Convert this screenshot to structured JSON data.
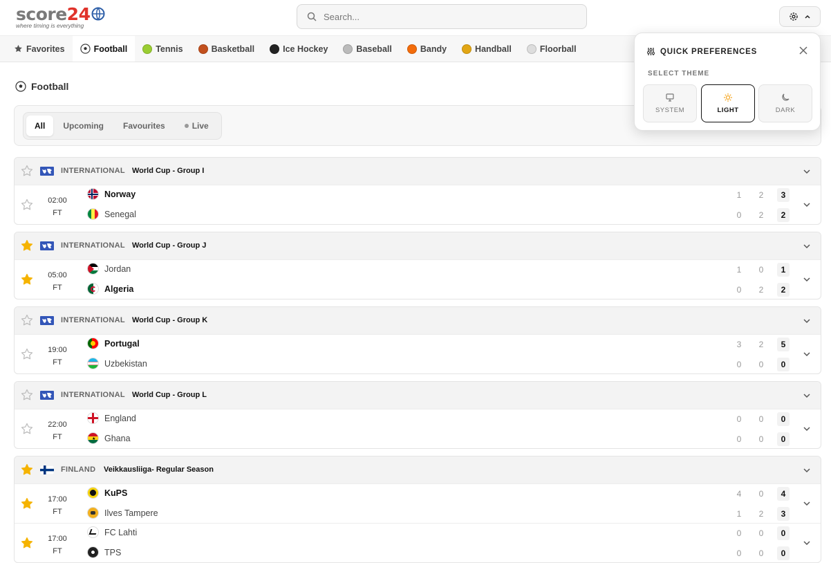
{
  "header": {
    "logo_main_grey": "score",
    "logo_main_red": "24",
    "logo_tagline": "where timing is everything",
    "search_placeholder": "Search..."
  },
  "sports": [
    {
      "label": "Favorites",
      "icon": "star-icon",
      "color": "#555"
    },
    {
      "label": "Football",
      "icon": "football-icon",
      "color": "#222",
      "active": true
    },
    {
      "label": "Tennis",
      "icon": "tennis-ball-icon",
      "color": "#9acd32"
    },
    {
      "label": "Basketball",
      "icon": "basketball-icon",
      "color": "#c2501e"
    },
    {
      "label": "Ice Hockey",
      "icon": "hockey-puck-icon",
      "color": "#222"
    },
    {
      "label": "Baseball",
      "icon": "baseball-icon",
      "color": "#bbb"
    },
    {
      "label": "Bandy",
      "icon": "bandy-ball-icon",
      "color": "#f36c0b"
    },
    {
      "label": "Handball",
      "icon": "handball-icon",
      "color": "#e2a614"
    },
    {
      "label": "Floorball",
      "icon": "floorball-icon",
      "color": "#ddd"
    }
  ],
  "section": {
    "title": "Football"
  },
  "filters": [
    {
      "label": "All",
      "active": true
    },
    {
      "label": "Upcoming"
    },
    {
      "label": "Favourites"
    },
    {
      "label": "Live"
    }
  ],
  "preferences": {
    "title": "QUICK PREFERENCES",
    "theme_label": "SELECT THEME",
    "themes": [
      {
        "label": "SYSTEM",
        "icon": "monitor-icon"
      },
      {
        "label": "LIGHT",
        "icon": "sun-icon",
        "active": true
      },
      {
        "label": "DARK",
        "icon": "moon-icon"
      }
    ]
  },
  "leagues": [
    {
      "country": "INTERNATIONAL",
      "name": "World Cup - Group I",
      "favorite": false,
      "flag": "world-flag-icon",
      "matches": [
        {
          "time": "02:00",
          "status": "FT",
          "favorite": false,
          "home": {
            "name": "Norway",
            "h1": "1",
            "h2": "2",
            "final": "3",
            "win": true
          },
          "away": {
            "name": "Senegal",
            "h1": "0",
            "h2": "2",
            "final": "2",
            "win": false
          }
        }
      ]
    },
    {
      "country": "INTERNATIONAL",
      "name": "World Cup - Group J",
      "favorite": true,
      "flag": "world-flag-icon",
      "matches": [
        {
          "time": "05:00",
          "status": "FT",
          "favorite": true,
          "home": {
            "name": "Jordan",
            "h1": "1",
            "h2": "0",
            "final": "1",
            "win": false
          },
          "away": {
            "name": "Algeria",
            "h1": "0",
            "h2": "2",
            "final": "2",
            "win": true
          }
        }
      ]
    },
    {
      "country": "INTERNATIONAL",
      "name": "World Cup - Group K",
      "favorite": false,
      "flag": "world-flag-icon",
      "matches": [
        {
          "time": "19:00",
          "status": "FT",
          "favorite": false,
          "home": {
            "name": "Portugal",
            "h1": "3",
            "h2": "2",
            "final": "5",
            "win": true
          },
          "away": {
            "name": "Uzbekistan",
            "h1": "0",
            "h2": "0",
            "final": "0",
            "win": false
          }
        }
      ]
    },
    {
      "country": "INTERNATIONAL",
      "name": "World Cup - Group L",
      "favorite": false,
      "flag": "world-flag-icon",
      "matches": [
        {
          "time": "22:00",
          "status": "FT",
          "favorite": false,
          "home": {
            "name": "England",
            "h1": "0",
            "h2": "0",
            "final": "0",
            "win": false
          },
          "away": {
            "name": "Ghana",
            "h1": "0",
            "h2": "0",
            "final": "0",
            "win": false
          }
        }
      ]
    },
    {
      "country": "FINLAND",
      "name": "Veikkausliiga- Regular Season",
      "favorite": true,
      "flag": "finland-flag-icon",
      "matches": [
        {
          "time": "17:00",
          "status": "FT",
          "favorite": true,
          "home": {
            "name": "KuPS",
            "h1": "4",
            "h2": "0",
            "final": "4",
            "win": true
          },
          "away": {
            "name": "Ilves Tampere",
            "h1": "1",
            "h2": "2",
            "final": "3",
            "win": false
          }
        },
        {
          "time": "17:00",
          "status": "FT",
          "favorite": true,
          "home": {
            "name": "FC Lahti",
            "h1": "0",
            "h2": "0",
            "final": "0",
            "win": false
          },
          "away": {
            "name": "TPS",
            "h1": "0",
            "h2": "0",
            "final": "0",
            "win": false
          }
        }
      ]
    }
  ],
  "colors": {
    "star_on": "#f5b301",
    "star_off": "#bbb",
    "accent_red": "#e0332b",
    "sun": "#f5a623"
  }
}
